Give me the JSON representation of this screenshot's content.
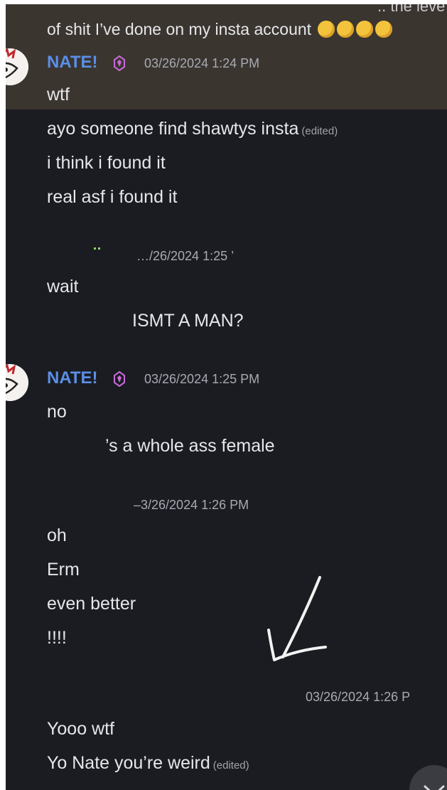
{
  "messages": {
    "top_partial": "of shit I’ve done on my insta account",
    "top_partial_cut": ".. the leve",
    "group1": {
      "author": "NATE!",
      "timestamp": "03/26/2024 1:24 PM",
      "lines": [
        "wtf",
        "ayo someone find shawtys insta",
        "i think i found it",
        "real asf i found it"
      ],
      "edited_label": "(edited)"
    },
    "group2": {
      "timestamp": "…/26/2024 1:25 ’",
      "lines": [
        "wait",
        "ISMT A MAN?"
      ]
    },
    "group3": {
      "author": "NATE!",
      "timestamp": "03/26/2024 1:25 PM",
      "lines": [
        "no",
        "’s a whole ass female"
      ]
    },
    "group4": {
      "timestamp": "–3/26/2024 1:26 PM",
      "lines": [
        "oh",
        "Erm",
        "even better",
        "!!!!"
      ]
    },
    "group5": {
      "timestamp": "03/26/2024 1:26 P",
      "lines": [
        "Yooo wtf",
        "Yo Nate you’re weird"
      ],
      "edited_label": "(edited)"
    }
  },
  "icons": {
    "laugh_emoji": "rolling-on-floor-laughing",
    "badge": "purple-gem-badge",
    "drawn_arrow": "hand-drawn-arrow",
    "jump_button": "chevron-down-icon"
  },
  "colors": {
    "background": "#1b1c21",
    "highlight": "#3b3530",
    "username": "#5b8fe6",
    "text": "#e6e7ea",
    "timestamp": "#a7aab3"
  }
}
